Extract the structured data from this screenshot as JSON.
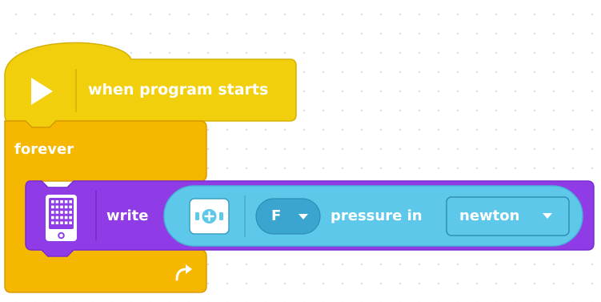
{
  "hat_block": {
    "label": "when program starts",
    "icon": "play-icon",
    "color": "#f2cf0c"
  },
  "forever_block": {
    "label": "forever",
    "loop_icon": "loop-arrow-icon",
    "color": "#f5b700"
  },
  "write_block": {
    "icon": "light-matrix-hub-icon",
    "label": "write",
    "color": "#8f3ce6",
    "reporter": {
      "icon": "force-sensor-icon",
      "color": "#5ec8ea",
      "port": "F",
      "measure_label": "pressure in",
      "unit": "newton"
    }
  }
}
